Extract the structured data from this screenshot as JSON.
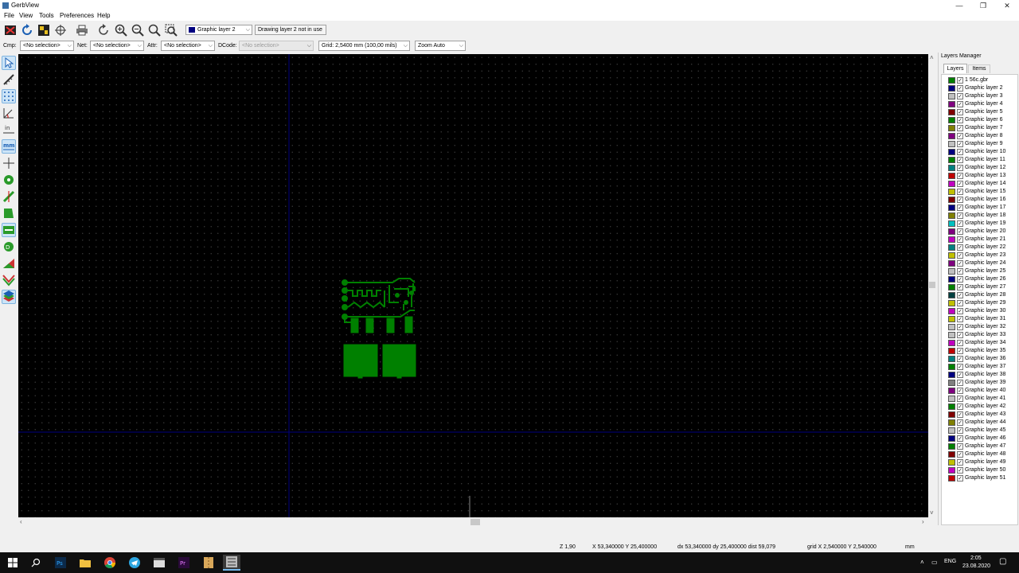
{
  "window": {
    "title": "GerbView",
    "minimize": "—",
    "maximize": "❐",
    "close": "✕"
  },
  "menu": [
    {
      "label": "File"
    },
    {
      "label": "View"
    },
    {
      "label": "Tools"
    },
    {
      "label": "Preferences"
    },
    {
      "label": "Help"
    }
  ],
  "toolbar": {
    "active_layer_combo": "Graphic layer 2",
    "active_layer_color": "#000080",
    "layer_status": "Drawing layer 2 not in use"
  },
  "filters": {
    "cmp_label": "Cmp:",
    "cmp_value": "<No selection>",
    "net_label": "Net:",
    "net_value": "<No selection>",
    "attr_label": "Attr:",
    "attr_value": "<No selection>",
    "dcode_label": "DCode:",
    "dcode_value": "<No selection>",
    "grid_value": "Grid: 2,5400 mm (100,00 mils)",
    "zoom_value": "Zoom Auto"
  },
  "layers_manager": {
    "title": "Layers Manager",
    "tabs": [
      {
        "label": "Layers"
      },
      {
        "label": "Items"
      }
    ],
    "layers": [
      {
        "name": "1 56c.gbr",
        "color": "#008000"
      },
      {
        "name": "Graphic layer 2",
        "color": "#000080"
      },
      {
        "name": "Graphic layer 3",
        "color": "#c0c0c0"
      },
      {
        "name": "Graphic layer 4",
        "color": "#800080"
      },
      {
        "name": "Graphic layer 5",
        "color": "#800000"
      },
      {
        "name": "Graphic layer 6",
        "color": "#008000"
      },
      {
        "name": "Graphic layer 7",
        "color": "#808000"
      },
      {
        "name": "Graphic layer 8",
        "color": "#800080"
      },
      {
        "name": "Graphic layer 9",
        "color": "#c0c0c0"
      },
      {
        "name": "Graphic layer 10",
        "color": "#000080"
      },
      {
        "name": "Graphic layer 11",
        "color": "#008000"
      },
      {
        "name": "Graphic layer 12",
        "color": "#008080"
      },
      {
        "name": "Graphic layer 13",
        "color": "#c00000"
      },
      {
        "name": "Graphic layer 14",
        "color": "#c000c0"
      },
      {
        "name": "Graphic layer 15",
        "color": "#c0c000"
      },
      {
        "name": "Graphic layer 16",
        "color": "#800000"
      },
      {
        "name": "Graphic layer 17",
        "color": "#000080"
      },
      {
        "name": "Graphic layer 18",
        "color": "#808000"
      },
      {
        "name": "Graphic layer 19",
        "color": "#00c0c0"
      },
      {
        "name": "Graphic layer 20",
        "color": "#800080"
      },
      {
        "name": "Graphic layer 21",
        "color": "#c000c0"
      },
      {
        "name": "Graphic layer 22",
        "color": "#008080"
      },
      {
        "name": "Graphic layer 23",
        "color": "#c0c000"
      },
      {
        "name": "Graphic layer 24",
        "color": "#800080"
      },
      {
        "name": "Graphic layer 25",
        "color": "#c0c0c0"
      },
      {
        "name": "Graphic layer 26",
        "color": "#000080"
      },
      {
        "name": "Graphic layer 27",
        "color": "#008000"
      },
      {
        "name": "Graphic layer 28",
        "color": "#004040"
      },
      {
        "name": "Graphic layer 29",
        "color": "#c0c000"
      },
      {
        "name": "Graphic layer 30",
        "color": "#c000c0"
      },
      {
        "name": "Graphic layer 31",
        "color": "#c0c000"
      },
      {
        "name": "Graphic layer 32",
        "color": "#c0c0c0"
      },
      {
        "name": "Graphic layer 33",
        "color": "#c0c0c0"
      },
      {
        "name": "Graphic layer 34",
        "color": "#c000c0"
      },
      {
        "name": "Graphic layer 35",
        "color": "#c00000"
      },
      {
        "name": "Graphic layer 36",
        "color": "#008080"
      },
      {
        "name": "Graphic layer 37",
        "color": "#008000"
      },
      {
        "name": "Graphic layer 38",
        "color": "#000080"
      },
      {
        "name": "Graphic layer 39",
        "color": "#808080"
      },
      {
        "name": "Graphic layer 40",
        "color": "#800080"
      },
      {
        "name": "Graphic layer 41",
        "color": "#c0c0c0"
      },
      {
        "name": "Graphic layer 42",
        "color": "#008000"
      },
      {
        "name": "Graphic layer 43",
        "color": "#800000"
      },
      {
        "name": "Graphic layer 44",
        "color": "#808000"
      },
      {
        "name": "Graphic layer 45",
        "color": "#c0c0c0"
      },
      {
        "name": "Graphic layer 46",
        "color": "#000080"
      },
      {
        "name": "Graphic layer 47",
        "color": "#008000"
      },
      {
        "name": "Graphic layer 48",
        "color": "#800000"
      },
      {
        "name": "Graphic layer 49",
        "color": "#c0c000"
      },
      {
        "name": "Graphic layer 50",
        "color": "#c000c0"
      },
      {
        "name": "Graphic layer 51",
        "color": "#c00000"
      }
    ]
  },
  "status": {
    "zoom": "Z 1,90",
    "abs": "X 53,340000  Y 25,400000",
    "rel": "dx 53,340000  dy 25,400000  dist 59,079",
    "grid": "grid X 2,540000  Y 2,540000",
    "units": "mm"
  },
  "taskbar": {
    "lang": "ENG",
    "time": "2:05",
    "date": "23.08.2020"
  },
  "colors": {
    "pcb_green": "#008000",
    "axis_blue": "#000080"
  }
}
